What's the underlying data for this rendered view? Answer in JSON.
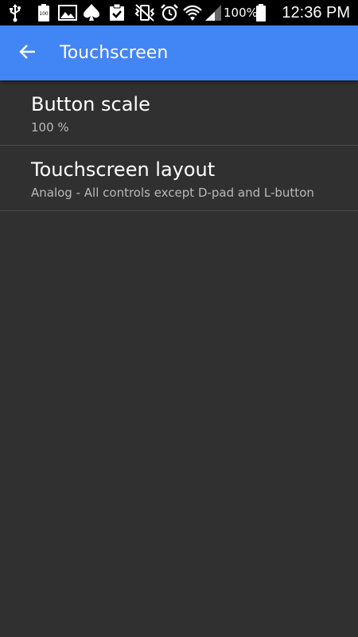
{
  "status_bar": {
    "battery_percent": "100%",
    "time": "12:36 PM",
    "icons": [
      "usb-icon",
      "battery-100-icon",
      "image-icon",
      "spade-icon",
      "clipboard-check-icon",
      "mute-vibrate-icon",
      "alarm-icon",
      "wifi-icon",
      "signal-icon",
      "battery-icon"
    ]
  },
  "app_bar": {
    "title": "Touchscreen",
    "color": "#4285f4"
  },
  "preferences": [
    {
      "title": "Button scale",
      "summary": "100 %"
    },
    {
      "title": "Touchscreen layout",
      "summary": "Analog - All controls except D-pad and L-button"
    }
  ]
}
